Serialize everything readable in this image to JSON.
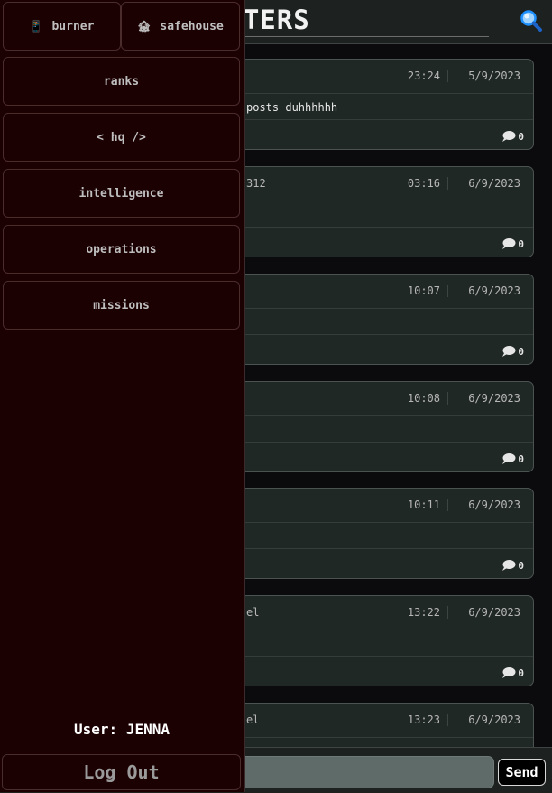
{
  "header": {
    "title": "QUARTERS"
  },
  "sidebar": {
    "top_buttons": [
      {
        "label": "burner",
        "icon": "phone-icon",
        "emoji": "📱"
      },
      {
        "label": "safehouse",
        "icon": "house-icon",
        "emoji": "🏚"
      }
    ],
    "items": [
      {
        "label": "ranks"
      },
      {
        "label": "< hq />"
      },
      {
        "label": "intelligence"
      },
      {
        "label": "operations"
      },
      {
        "label": "missions"
      }
    ],
    "user_label": "User: JENNA",
    "logout_label": "Log Out"
  },
  "posts": [
    {
      "author": "",
      "time": "23:24",
      "date": "5/9/2023",
      "body": "posts duhhhhhh",
      "comments": "0"
    },
    {
      "author": "312",
      "time": "03:16",
      "date": "6/9/2023",
      "body": "",
      "comments": "0"
    },
    {
      "author": "",
      "time": "10:07",
      "date": "6/9/2023",
      "body": "",
      "comments": "0"
    },
    {
      "author": "",
      "time": "10:08",
      "date": "6/9/2023",
      "body": "",
      "comments": "0"
    },
    {
      "author": "",
      "time": "10:11",
      "date": "6/9/2023",
      "body": "",
      "comments": "0"
    },
    {
      "author": "el",
      "time": "13:22",
      "date": "6/9/2023",
      "body": "",
      "comments": "0"
    },
    {
      "author": "el",
      "time": "13:23",
      "date": "6/9/2023",
      "body": "",
      "comments": ""
    }
  ],
  "composer": {
    "input_value": "",
    "send_label": "Send"
  },
  "colors": {
    "sidebar_bg": "#1c0103",
    "card_bg": "#202826",
    "header_bg": "#1d2221",
    "search_accent": "#1e90ff"
  }
}
